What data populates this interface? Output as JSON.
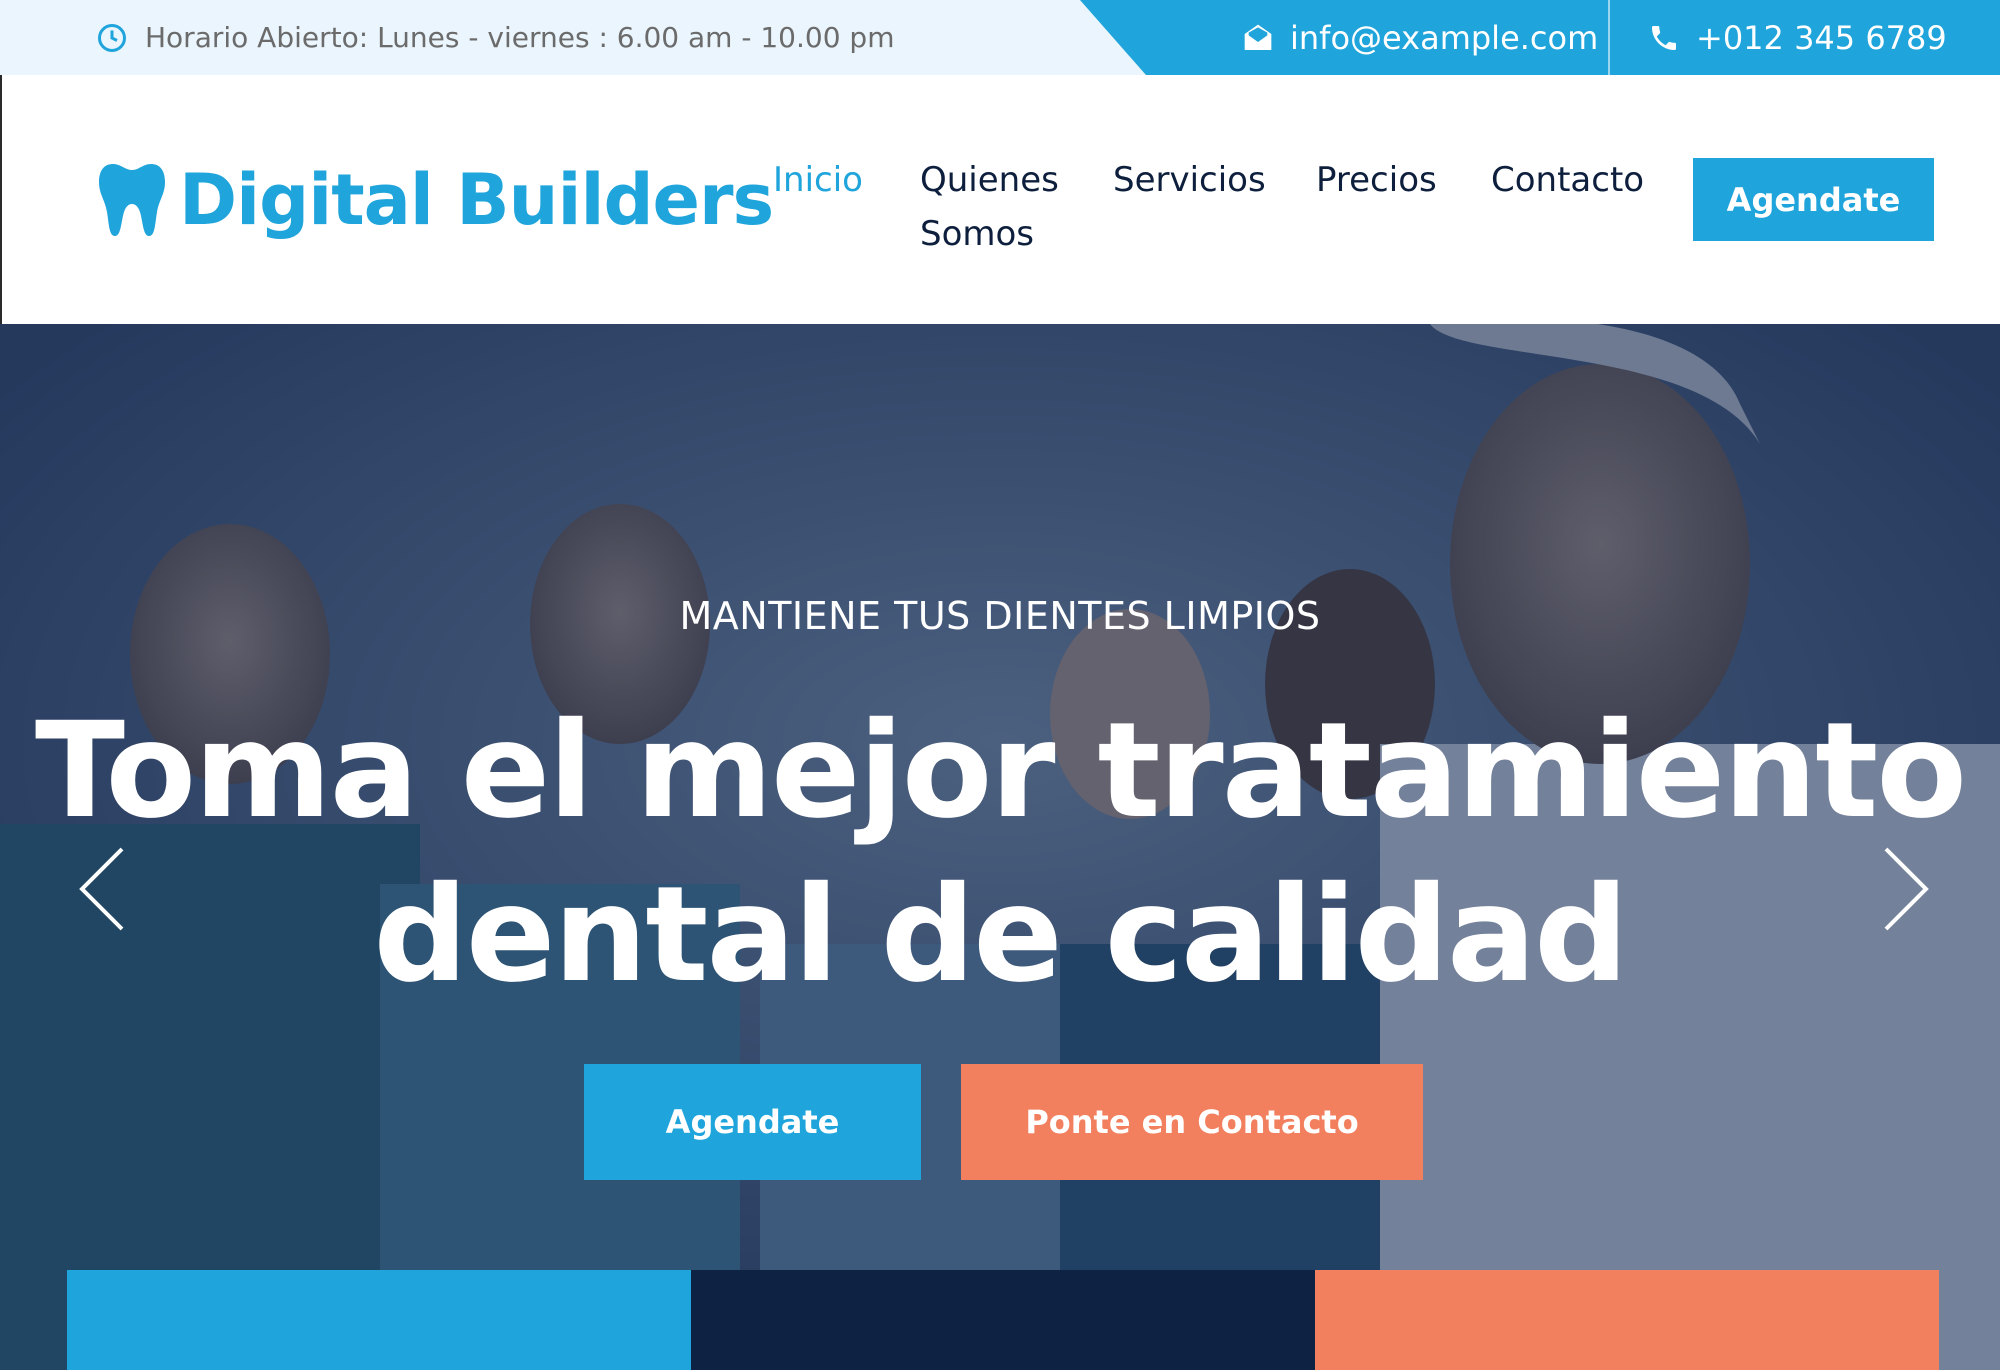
{
  "topbar": {
    "hours": "Horario Abierto: Lunes - viernes : 6.00 am - 10.00 pm",
    "email": "info@example.com",
    "phone": "+012 345 6789",
    "icons": [
      "clock-icon",
      "envelope-open-icon",
      "phone-icon"
    ]
  },
  "brand": {
    "name": "Digital Builders",
    "icon": "tooth-icon",
    "color": "#1fa4db"
  },
  "nav": {
    "items": [
      {
        "label": "Inicio",
        "active": true
      },
      {
        "label_line1": "Quienes",
        "label_line2": "Somos",
        "active": false
      },
      {
        "label": "Servicios",
        "active": false
      },
      {
        "label": "Precios",
        "active": false
      },
      {
        "label": "Contacto",
        "active": false
      }
    ],
    "cta": "Agendate"
  },
  "hero": {
    "subtitle": "MANTIENE TUS DIENTES LIMPIOS",
    "title_line1": "Toma el mejor tratamiento",
    "title_line2": "dental de calidad",
    "primary_button": "Agendate",
    "secondary_button": "Ponte en Contacto",
    "prev_icon": "chevron-left-icon",
    "next_icon": "chevron-right-icon"
  },
  "colors": {
    "primary": "#1fa4db",
    "dark": "#0e2244",
    "accent": "#f27f5d"
  }
}
